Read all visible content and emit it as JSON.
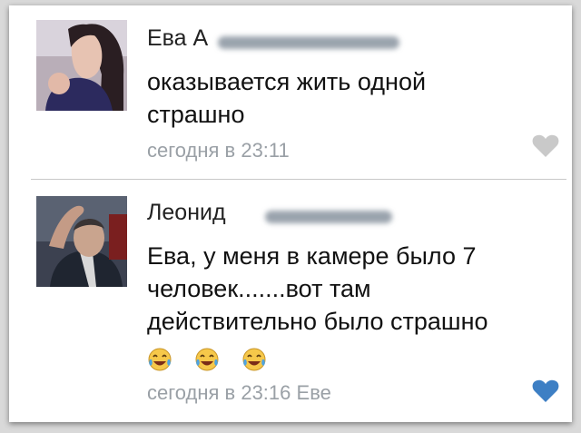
{
  "comments": [
    {
      "author_visible": "Ева А",
      "text": "оказывается жить одной\nстрашно",
      "timestamp": "сегодня в 23:11",
      "reply_to": "",
      "like_icon": "heart-icon",
      "liked": false
    },
    {
      "author_visible": "Леонид",
      "text": "Ева, у меня в камере было 7\nчеловек.......вот там\nдействительно было страшно",
      "emojis": [
        "tears-of-joy-emoji",
        "tears-of-joy-emoji",
        "tears-of-joy-emoji"
      ],
      "timestamp": "сегодня в 23:16",
      "reply_to": "Еве",
      "like_icon": "heart-icon",
      "liked": true
    }
  ],
  "colors": {
    "heart_inactive": "#c9c9c9",
    "heart_active": "#3d7fc4",
    "meta_text": "#9aa0a6"
  }
}
